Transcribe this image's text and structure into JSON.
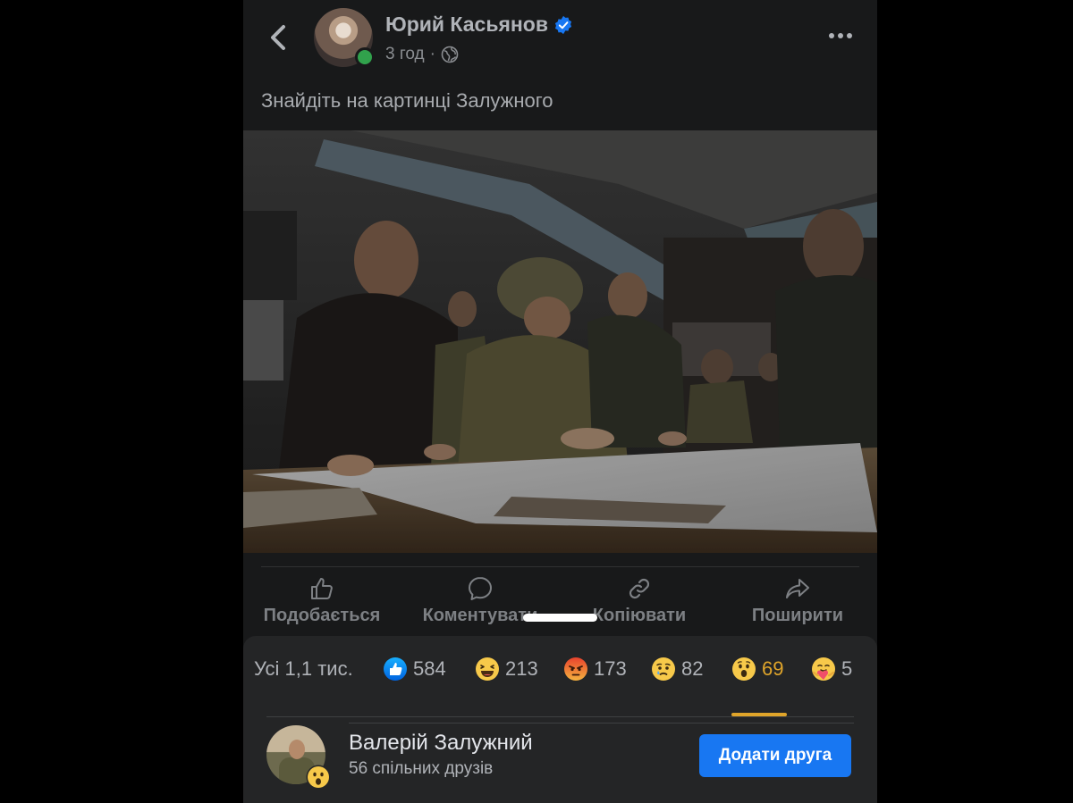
{
  "post": {
    "author": "Юрий Касьянов",
    "time": "3 год",
    "separator": "·",
    "text": "Знайдіть на картинці Залужного",
    "verified_icon": "verified-badge-icon",
    "privacy_icon": "globe-icon"
  },
  "actions": [
    {
      "label": "Подобається",
      "icon": "thumbs-up-icon"
    },
    {
      "label": "Коментувати",
      "icon": "comment-icon"
    },
    {
      "label": "Копіювати",
      "icon": "link-icon"
    },
    {
      "label": "Поширити",
      "icon": "share-icon"
    }
  ],
  "reactions": {
    "all_label": "Усі 1,1 тис.",
    "tabs": [
      {
        "type": "like",
        "count": "584",
        "icon": "like-reaction-icon"
      },
      {
        "type": "haha",
        "count": "213",
        "icon": "haha-reaction-icon"
      },
      {
        "type": "angry",
        "count": "173",
        "icon": "angry-reaction-icon"
      },
      {
        "type": "sad",
        "count": "82",
        "icon": "sad-reaction-icon"
      },
      {
        "type": "wow",
        "count": "69",
        "icon": "wow-reaction-icon",
        "active": true
      },
      {
        "type": "care",
        "count": "5",
        "icon": "care-reaction-icon"
      }
    ]
  },
  "person": {
    "name": "Валерій Залужний",
    "mutual": "56 спільних друзів",
    "button": "Додати друга",
    "reaction": "wow"
  },
  "colors": {
    "accent": "#e0a52a",
    "button": "#1877f2",
    "background": "#18191a",
    "sheet": "#242526"
  }
}
